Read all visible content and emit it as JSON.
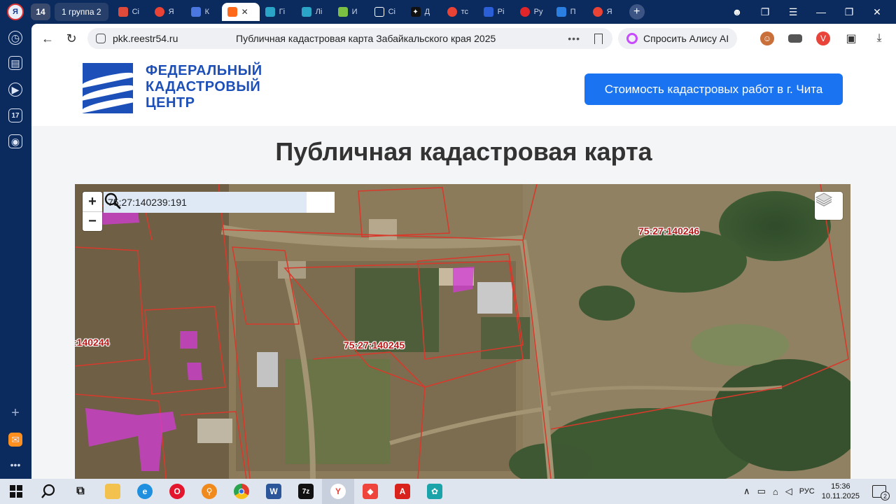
{
  "browser": {
    "tab_count": "14",
    "group_label": "1  группа 2",
    "tabs": [
      {
        "label": "Сі",
        "color": "#e04a3a"
      },
      {
        "label": "Я",
        "color": "#e84335"
      },
      {
        "label": "К",
        "color": "#4a78e0"
      },
      {
        "label": "",
        "color": "#ff6a1a",
        "active": true
      },
      {
        "label": "Гі",
        "color": "#2aa5c8"
      },
      {
        "label": "Лі",
        "color": "#2aa5c8"
      },
      {
        "label": "И",
        "color": "#7bc043"
      },
      {
        "label": "Сі",
        "color": "#ffffff"
      },
      {
        "label": "Д",
        "color": "#111111"
      },
      {
        "label": "тс",
        "color": "#e84335"
      },
      {
        "label": "Рі",
        "color": "#2a5fd8"
      },
      {
        "label": "Ру",
        "color": "#e0262b"
      },
      {
        "label": "П",
        "color": "#2a7fe0"
      },
      {
        "label": "Я",
        "color": "#e84335"
      }
    ],
    "url_domain": "pkk.reestr54.ru",
    "page_title": "Публичная кадастровая карта Забайкальского края 2025",
    "alice_label": "Спросить Алису AI"
  },
  "site": {
    "logo_line1": "ФЕДЕРАЛЬНЫЙ",
    "logo_line2": "КАДАСТРОВЫЙ",
    "logo_line3": "ЦЕНТР",
    "cta_label": "Стоимость кадастровых работ в г. Чита",
    "title": "Публичная кадастровая карта"
  },
  "map": {
    "zoom_in": "+",
    "zoom_out": "−",
    "search_value": "75:27:140239:191",
    "labels": [
      {
        "text": "75:27:140246"
      },
      {
        "text": "75:27:140245"
      },
      {
        "text": ":140244"
      }
    ]
  },
  "taskbar": {
    "lang": "РУС",
    "time": "15:36",
    "date": "10.11.2025",
    "notifications": "2"
  }
}
